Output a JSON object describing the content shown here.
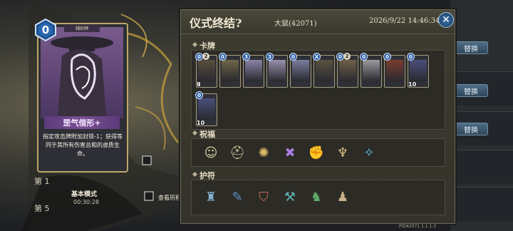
{
  "modal": {
    "title": "仪式终结?",
    "player": "大鼠(42071)",
    "datetime": "2026/9/22 14:46:34",
    "close_icon": "close-icon"
  },
  "sections": {
    "cards_label": "卡牌",
    "blessings_label": "祝福",
    "amulets_label": "护符"
  },
  "deck": [
    {
      "cost": "0",
      "extra": "2",
      "count": "2",
      "art": "#5a4e3c"
    },
    {
      "cost": "0",
      "extra": "",
      "count": "",
      "art": "#6e6648"
    },
    {
      "cost": "3",
      "extra": "",
      "count": "",
      "art": "#8a82a6"
    },
    {
      "cost": "3",
      "extra": "",
      "count": "",
      "art": "#9890ac"
    },
    {
      "cost": "0",
      "extra": "",
      "count": "",
      "art": "#7b7ea0"
    },
    {
      "cost": "X",
      "extra": "",
      "count": "",
      "art": "#5a5240"
    },
    {
      "cost": "0",
      "extra": "2",
      "count": "",
      "art": "#6e6048"
    },
    {
      "cost": "0",
      "extra": "",
      "count": "",
      "art": "#9c9a9f"
    },
    {
      "cost": "0",
      "extra": "",
      "count": "",
      "art": "#7a3d2f"
    },
    {
      "cost": "0",
      "extra": "",
      "count": "10",
      "art": "#4b4f7a"
    },
    {
      "cost": "0",
      "extra": "",
      "count": "10",
      "art": "#4b4f7a"
    }
  ],
  "first_card_bottom": "9",
  "blessings": [
    "mask-icon",
    "helmet-icon",
    "swirl-emblem-icon",
    "crossed-blades-icon",
    "fist-aura-icon",
    "winged-crest-icon",
    "sparkle-cross-icon"
  ],
  "amulets": [
    "lantern-icon",
    "scroll-icon",
    "shield-orb-icon",
    "mace-icon",
    "totem-icon",
    "boot-icon"
  ],
  "selected_card": {
    "type_label": "辅助牌",
    "cost": "0",
    "name": "罡气借形+",
    "description": "指定攻击牌附加封锁-1；获得等同于其所有伤害总和的虚质生命。"
  },
  "sidebar": {
    "mode_label": "基本模式",
    "mode_time": "00:30:28",
    "history_label": "查看历程",
    "row1": "第 1",
    "row2": "第 5"
  },
  "right_buttons": [
    "替换",
    "替换",
    "替换"
  ],
  "footer_id": "PID42071 1.1.1.3",
  "colors": {
    "accent": "#2a5ea8",
    "panel": "#3d3b30",
    "name_bar": "#7a4e93"
  }
}
